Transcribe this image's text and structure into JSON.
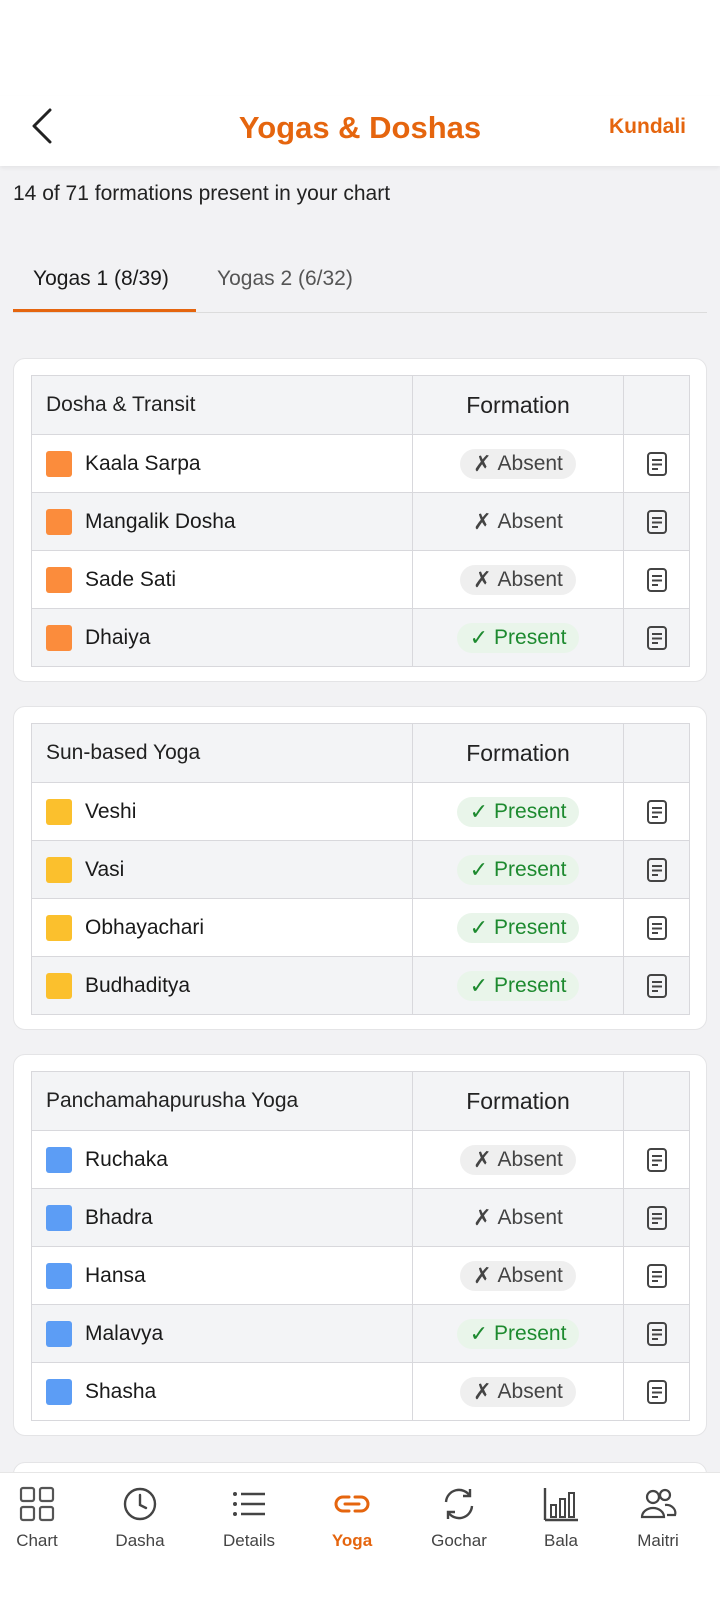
{
  "header": {
    "title": "Yogas & Doshas",
    "action": "Kundali"
  },
  "summary": "14 of 71 formations present in your chart",
  "tabs": [
    {
      "label": "Yogas 1 (8/39)",
      "active": true
    },
    {
      "label": "Yogas 2 (6/32)",
      "active": false
    }
  ],
  "formation_header": "Formation",
  "status": {
    "absent": "Absent",
    "present": "Present",
    "absent_glyph": "✗",
    "present_glyph": "✓"
  },
  "colors": {
    "accent": "#e5650e",
    "dosha": "#fb8c3c",
    "sun": "#fbc02d",
    "pancha": "#5c9df5",
    "present_text": "#1d8a2f",
    "present_bg": "#e9f5ea"
  },
  "sections": [
    {
      "title": "Dosha & Transit",
      "color_key": "dosha",
      "rows": [
        {
          "name": "Kaala Sarpa",
          "status": "absent"
        },
        {
          "name": "Mangalik Dosha",
          "status": "absent"
        },
        {
          "name": "Sade Sati",
          "status": "absent"
        },
        {
          "name": "Dhaiya",
          "status": "present"
        }
      ]
    },
    {
      "title": "Sun-based Yoga",
      "color_key": "sun",
      "rows": [
        {
          "name": "Veshi",
          "status": "present"
        },
        {
          "name": "Vasi",
          "status": "present"
        },
        {
          "name": "Obhayachari",
          "status": "present"
        },
        {
          "name": "Budhaditya",
          "status": "present"
        }
      ]
    },
    {
      "title": "Panchamahapurusha Yoga",
      "color_key": "pancha",
      "rows": [
        {
          "name": "Ruchaka",
          "status": "absent"
        },
        {
          "name": "Bhadra",
          "status": "absent"
        },
        {
          "name": "Hansa",
          "status": "absent"
        },
        {
          "name": "Malavya",
          "status": "present"
        },
        {
          "name": "Shasha",
          "status": "absent"
        }
      ]
    }
  ],
  "bottom_nav": [
    {
      "label": "Chart",
      "icon": "grid-icon",
      "active": false
    },
    {
      "label": "Dasha",
      "icon": "clock-icon",
      "active": false
    },
    {
      "label": "Details",
      "icon": "list-icon",
      "active": false
    },
    {
      "label": "Yoga",
      "icon": "link-icon",
      "active": true
    },
    {
      "label": "Gochar",
      "icon": "sync-icon",
      "active": false
    },
    {
      "label": "Bala",
      "icon": "bar-chart-icon",
      "active": false
    },
    {
      "label": "Maitri",
      "icon": "people-icon",
      "active": false
    }
  ]
}
